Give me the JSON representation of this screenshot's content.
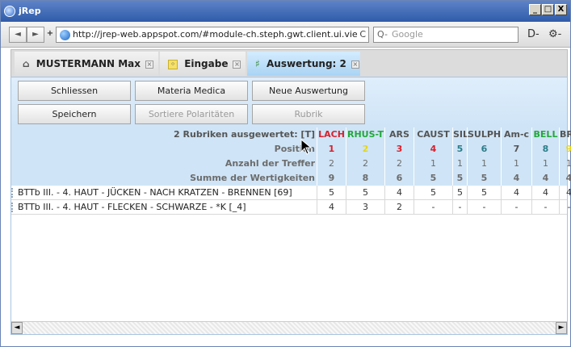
{
  "window": {
    "title": "jRep",
    "min": "_",
    "max": "□",
    "close": "X"
  },
  "browser": {
    "back": "◄",
    "forward": "►",
    "add": "+",
    "url": "http://jrep-web.appspot.com/#module-ch.steph.gwt.client.ui.vie",
    "reload": "C",
    "search_placeholder": "Google",
    "search_icon": "Q-",
    "page_menu": "D-",
    "tools_menu": "⚙-"
  },
  "tabs": [
    {
      "label": "MUSTERMANN Max",
      "icon": "home-icon",
      "active": false
    },
    {
      "label": "Eingabe",
      "icon": "input-icon",
      "active": false
    },
    {
      "label": "Auswertung: 2",
      "icon": "chart-icon",
      "active": true
    }
  ],
  "actions": {
    "schliessen": "Schliessen",
    "materia_medica": "Materia Medica",
    "neue_auswertung": "Neue Auswertung",
    "speichern": "Speichern",
    "sortiere": "Sortiere Polaritäten",
    "rubrik": "Rubrik"
  },
  "grid": {
    "summary": "2 Rubriken ausgewertet: [T]",
    "remedies": [
      "LACH",
      "RHUS-T",
      "ARS",
      "CAUST",
      "SIL",
      "SULPH",
      "Am-c",
      "BELL",
      "BRY"
    ],
    "remedy_colors": [
      "#d9202c",
      "#22a83a",
      "#555555",
      "#555555",
      "#555555",
      "#555555",
      "#555555",
      "#22a83a",
      "#555555"
    ],
    "position_label": "Position",
    "positions": [
      "1",
      "2",
      "3",
      "4",
      "5",
      "6",
      "7",
      "8",
      "9"
    ],
    "position_colors": [
      "#d9202c",
      "#e5d61c",
      "#d9202c",
      "#d9202c",
      "#2b7d8a",
      "#2b7d8a",
      "#555555",
      "#2b7d8a",
      "#e5d61c"
    ],
    "treffer_label": "Anzahl der Treffer",
    "treffer": [
      "2",
      "2",
      "2",
      "1",
      "1",
      "1",
      "1",
      "1",
      "1"
    ],
    "summe_label": "Summe der Wertigkeiten",
    "summe": [
      "9",
      "8",
      "6",
      "5",
      "5",
      "5",
      "4",
      "4",
      "4"
    ],
    "rows": [
      {
        "label": "BTTb  III. - 4. HAUT - JÜCKEN - NACH KRATZEN - BRENNEN [69]",
        "values": [
          "5",
          "5",
          "4",
          "5",
          "5",
          "5",
          "4",
          "4",
          "4"
        ]
      },
      {
        "label": "BTTb  III. - 4. HAUT - FLECKEN - SCHWARZE - *K  [_4]",
        "values": [
          "4",
          "3",
          "2",
          "-",
          "-",
          "-",
          "-",
          "-",
          "-"
        ]
      }
    ]
  },
  "scrollbar": {
    "left": "◄",
    "right": "►"
  }
}
